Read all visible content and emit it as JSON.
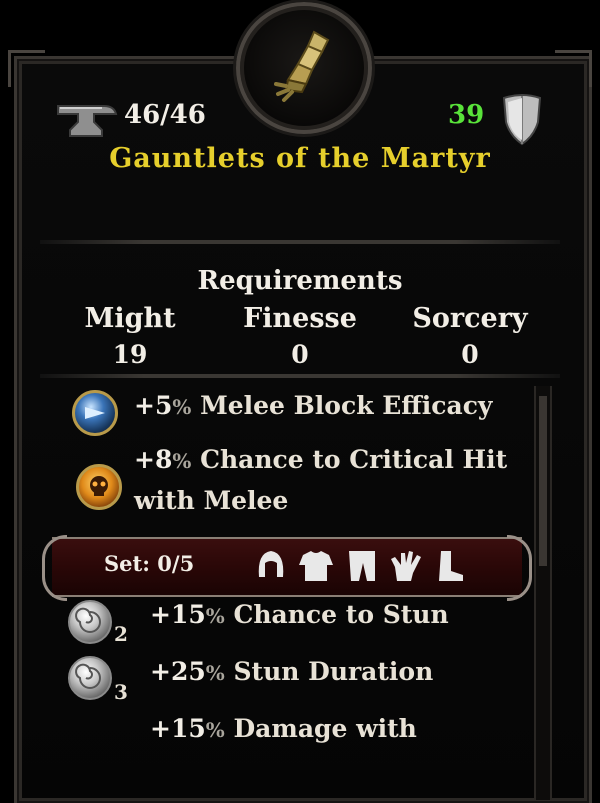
{
  "item": {
    "name": "Gauntlets of the Martyr",
    "durability": "46/46",
    "armor": "39",
    "icon": "gauntlet-icon"
  },
  "requirements": {
    "title": "Requirements",
    "stats": [
      {
        "label": "Might",
        "value": "19"
      },
      {
        "label": "Finesse",
        "value": "0"
      },
      {
        "label": "Sorcery",
        "value": "0"
      }
    ]
  },
  "bonuses": [
    {
      "icon": "shield-orb-icon",
      "value": "+5",
      "pct": "%",
      "text": "Melee Block Efficacy"
    },
    {
      "icon": "skull-orb-icon",
      "value": "+8",
      "pct": "%",
      "text": "Chance to Critical Hit",
      "text2": "with Melee"
    }
  ],
  "set": {
    "label": "Set: 0/5",
    "pieces": [
      "helm-icon",
      "chest-icon",
      "legs-icon",
      "gloves-icon",
      "boots-icon"
    ]
  },
  "set_bonuses": [
    {
      "tier": "2",
      "value": "+15",
      "pct": "%",
      "text": "Chance to Stun"
    },
    {
      "tier": "3",
      "value": "+25",
      "pct": "%",
      "text": "Stun Duration"
    },
    {
      "value": "+15",
      "pct": "%",
      "text": "Damage with"
    }
  ],
  "colors": {
    "title": "#e6cf2c",
    "armor": "#59e33a",
    "set_bar": "#2a0707"
  }
}
